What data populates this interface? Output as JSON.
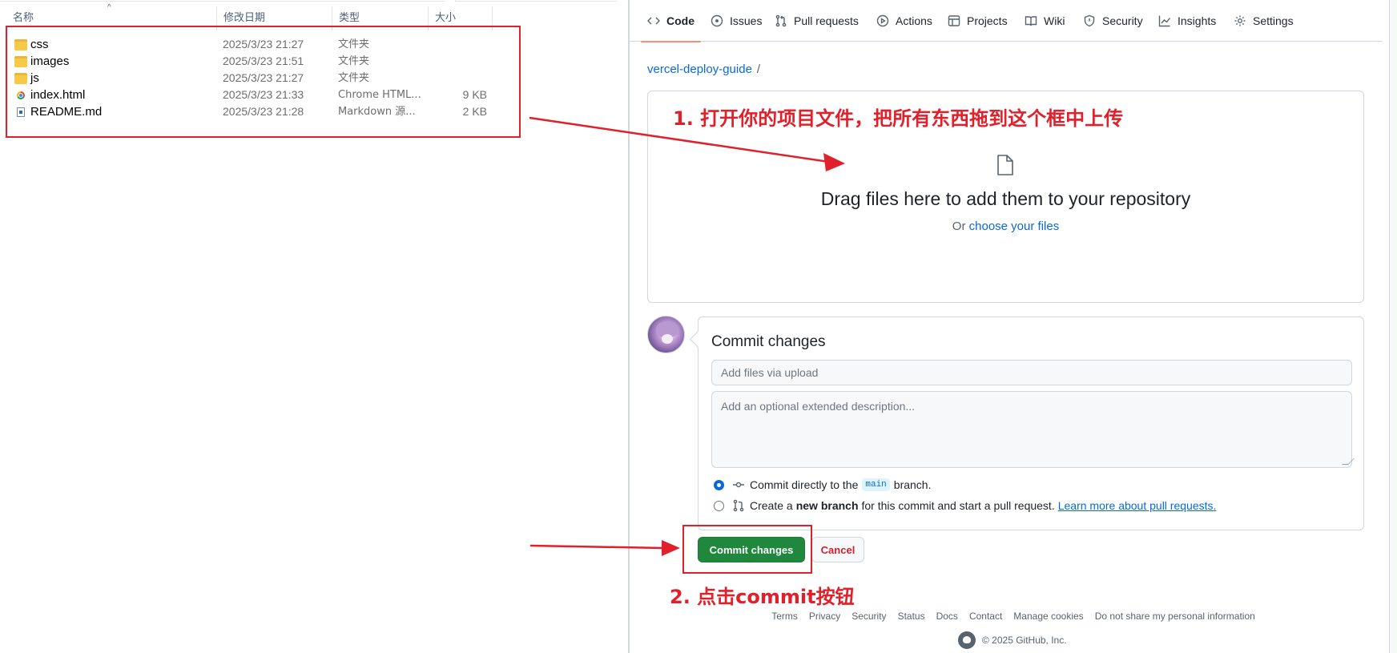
{
  "explorer": {
    "columns": {
      "name": "名称",
      "date": "修改日期",
      "type": "类型",
      "size": "大小"
    },
    "files": [
      {
        "icon": "folder-icon",
        "name": "css",
        "date": "2025/3/23 21:27",
        "type": "文件夹",
        "size": ""
      },
      {
        "icon": "folder-icon",
        "name": "images",
        "date": "2025/3/23 21:51",
        "type": "文件夹",
        "size": ""
      },
      {
        "icon": "folder-icon",
        "name": "js",
        "date": "2025/3/23 21:27",
        "type": "文件夹",
        "size": ""
      },
      {
        "icon": "chrome-html-icon",
        "name": "index.html",
        "date": "2025/3/23 21:33",
        "type": "Chrome HTML...",
        "size": "9 KB"
      },
      {
        "icon": "markdown-file-icon",
        "name": "README.md",
        "date": "2025/3/23 21:28",
        "type": "Markdown 源...",
        "size": "2 KB"
      }
    ]
  },
  "github": {
    "tabs": [
      {
        "label": "Code",
        "icon": "code-icon",
        "active": true
      },
      {
        "label": "Issues",
        "icon": "issue-icon"
      },
      {
        "label": "Pull requests",
        "icon": "pull-request-icon"
      },
      {
        "label": "Actions",
        "icon": "play-icon"
      },
      {
        "label": "Projects",
        "icon": "table-icon"
      },
      {
        "label": "Wiki",
        "icon": "book-icon"
      },
      {
        "label": "Security",
        "icon": "shield-icon"
      },
      {
        "label": "Insights",
        "icon": "graph-icon"
      },
      {
        "label": "Settings",
        "icon": "gear-icon"
      }
    ],
    "repo_name": "vercel-deploy-guide",
    "breadcrumb_separator": "/",
    "dropzone": {
      "title": "Drag files here to add them to your repository",
      "or_text": "Or",
      "choose_link": "choose your files"
    },
    "commit": {
      "heading": "Commit changes",
      "summary_placeholder": "Add files via upload",
      "description_placeholder": "Add an optional extended description...",
      "option_direct": {
        "prefix": "Commit directly to the",
        "branch": "main",
        "suffix": "branch.",
        "checked": true
      },
      "option_new_branch": {
        "prefix": "Create a",
        "bold": "new branch",
        "middle": "for this commit and start a pull request.",
        "link": "Learn more about pull requests.",
        "checked": false
      },
      "commit_button": "Commit changes",
      "cancel_button": "Cancel"
    },
    "footer": {
      "links": [
        "Terms",
        "Privacy",
        "Security",
        "Status",
        "Docs",
        "Contact",
        "Manage cookies",
        "Do not share my personal information"
      ],
      "copyright": "© 2025 GitHub, Inc."
    }
  },
  "annotations": {
    "step1": "1. 打开你的项目文件，把所有东西拖到这个框中上传",
    "step2": "2. 点击commit按钮"
  },
  "colors": {
    "annotation_red": "#e0202a",
    "primary_green": "#1f883d",
    "link_blue": "#0969da"
  }
}
